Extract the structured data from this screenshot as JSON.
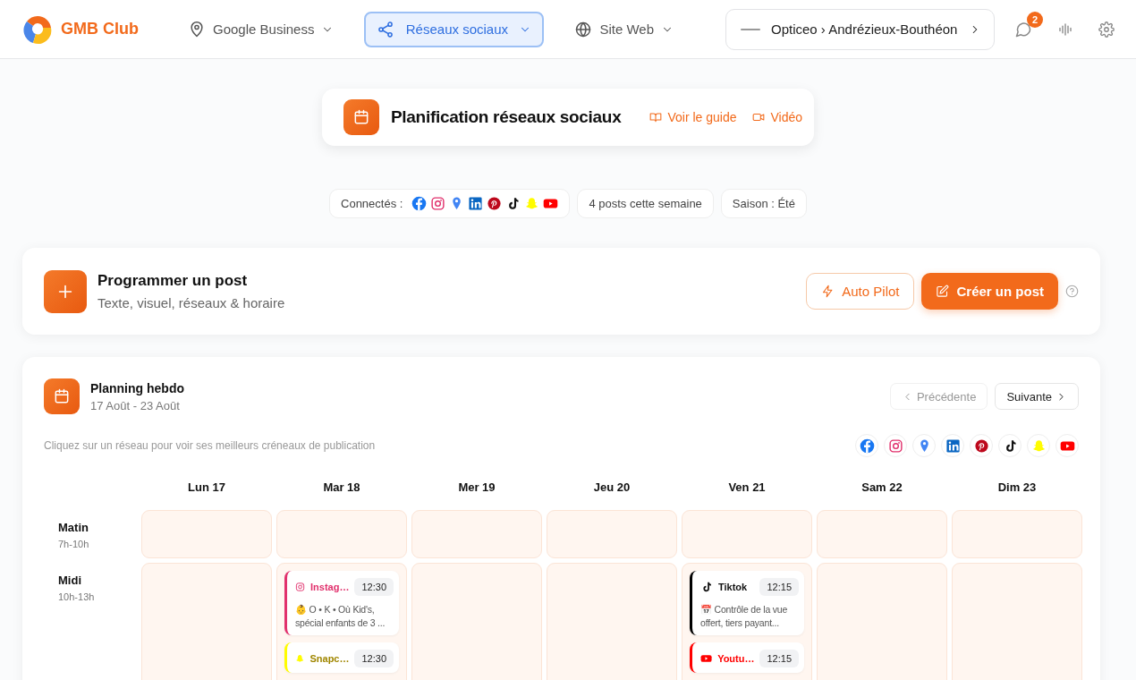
{
  "brand": {
    "name": "GMB Club"
  },
  "nav": [
    {
      "kind": "pin",
      "label": "Google Business",
      "selected": false
    },
    {
      "kind": "share",
      "label": "Réseaux sociaux",
      "selected": true
    },
    {
      "kind": "globe",
      "label": "Site Web",
      "selected": false
    }
  ],
  "account": {
    "label": "Opticeo › Andrézieux-Bouthéon"
  },
  "notifications": {
    "count": "2"
  },
  "title_card": {
    "title": "Planification réseaux sociaux",
    "links": [
      {
        "kind": "book",
        "label": "Voir le guide"
      },
      {
        "kind": "video",
        "label": "Vidéo"
      }
    ]
  },
  "chips": {
    "connected_label": "Connectés :",
    "networks": [
      {
        "kind": "facebook"
      },
      {
        "kind": "instagram"
      },
      {
        "kind": "maps"
      },
      {
        "kind": "linkedin"
      },
      {
        "kind": "pinterest"
      },
      {
        "kind": "tiktok"
      },
      {
        "kind": "snapchat"
      },
      {
        "kind": "youtube"
      }
    ],
    "items": [
      "4 posts cette semaine",
      "Saison : Été"
    ]
  },
  "program": {
    "title": "Programmer un post",
    "subtitle": "Texte, visuel, réseaux & horaire",
    "buttons": [
      {
        "kind": "outline",
        "label": "Auto Pilot"
      },
      {
        "kind": "primary",
        "label": "Créer un post"
      }
    ]
  },
  "planning": {
    "title": "Planning hebdo",
    "range": "17 Août - 23 Août",
    "prev": {
      "label": "Précédente",
      "disabled": true
    },
    "next": {
      "label": "Suivante",
      "disabled": false
    },
    "hint": "Cliquez sur un réseau pour voir ses meilleurs créneaux de publication",
    "networks": [
      {
        "kind": "facebook"
      },
      {
        "kind": "instagram"
      },
      {
        "kind": "maps"
      },
      {
        "kind": "linkedin"
      },
      {
        "kind": "pinterest"
      },
      {
        "kind": "tiktok"
      },
      {
        "kind": "snapchat"
      },
      {
        "kind": "youtube"
      }
    ],
    "days": [
      "Lun 17",
      "Mar 18",
      "Mer 19",
      "Jeu 20",
      "Ven 21",
      "Sam 22",
      "Dim 23"
    ],
    "slots": [
      {
        "name": "Matin",
        "hours": "7h-10h",
        "cells": [
          [],
          [],
          [],
          [],
          [],
          [],
          []
        ]
      },
      {
        "name": "Midi",
        "hours": "10h-13h",
        "cells": [
          [],
          [
            {
              "kind": "instagram",
              "color": "#e1306c",
              "label": "Instag…",
              "time": "12:30",
              "text": "👶 O • K • Où Kid's, spécial enfants de 3 ..."
            },
            {
              "kind": "snapchat",
              "color": "#fffc00",
              "label": "Snapc…",
              "time": "12:30"
            }
          ],
          [],
          [],
          [
            {
              "kind": "tiktok",
              "color": "#000000",
              "label": "Tiktok",
              "time": "12:15",
              "text": "📅 Contrôle de la vue offert, tiers payant..."
            },
            {
              "kind": "youtube",
              "color": "#ff0000",
              "label": "Youtu…",
              "time": "12:15"
            }
          ],
          [],
          []
        ]
      }
    ]
  }
}
